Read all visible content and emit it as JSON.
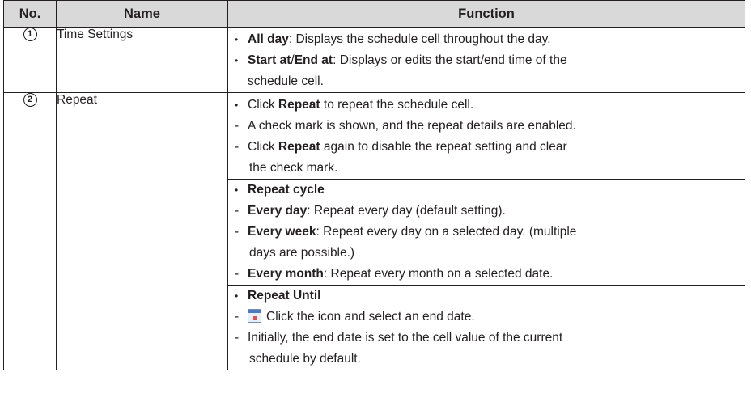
{
  "header": {
    "no": "No.",
    "name": "Name",
    "function": "Function"
  },
  "rows": [
    {
      "no": "1",
      "name": "Time Settings",
      "items": [
        {
          "type": "bullet",
          "bold": "All day",
          "text": ": Displays the schedule cell throughout the day."
        },
        {
          "type": "bullet",
          "bold": "Start at",
          "sep": "/",
          "bold2": "End at",
          "text": ": Displays or edits the start/end time of the"
        },
        {
          "type": "cont",
          "text": "schedule cell."
        }
      ]
    },
    {
      "no": "2",
      "name": "Repeat",
      "items": [
        {
          "type": "bullet",
          "pre": "Click ",
          "bold": "Repeat",
          "text": " to repeat the schedule cell."
        },
        {
          "type": "dash",
          "text": "A check mark is shown, and the repeat details are enabled."
        },
        {
          "type": "dash",
          "pre": "Click ",
          "bold": "Repeat",
          "text": " again to disable the repeat setting and clear"
        },
        {
          "type": "dashcont",
          "text": "the check mark."
        },
        {
          "type": "bullet-sep",
          "bold": "Repeat cycle"
        },
        {
          "type": "dash",
          "bold": "Every day",
          "text": ": Repeat every day (default setting)."
        },
        {
          "type": "dash",
          "bold": "Every week",
          "text": ": Repeat every day on a selected day. (multiple"
        },
        {
          "type": "dashcont",
          "text": "days are possible.)"
        },
        {
          "type": "dash",
          "bold": "Every month",
          "text": ": Repeat every month on a selected date."
        },
        {
          "type": "bullet-sep",
          "bold": "Repeat Until"
        },
        {
          "type": "dash-icon",
          "icon": "calendar-icon",
          "text": "Click the icon and select an end date."
        },
        {
          "type": "dash",
          "text": "Initially, the end date is set to the cell value of the current"
        },
        {
          "type": "dashcont",
          "text": "schedule by default."
        }
      ]
    }
  ]
}
